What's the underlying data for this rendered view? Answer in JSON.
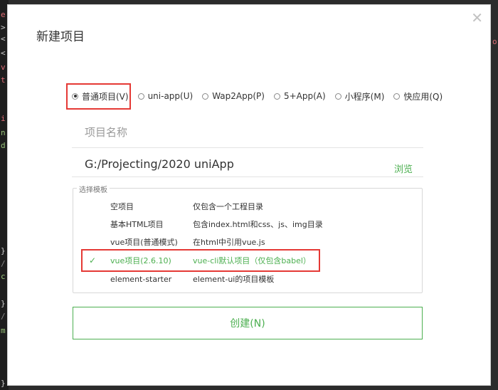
{
  "dialog": {
    "title": "新建项目",
    "close_symbol": "✕"
  },
  "project_types": [
    {
      "label": "普通项目(V)",
      "checked": true
    },
    {
      "label": "uni-app(U)",
      "checked": false
    },
    {
      "label": "Wap2App(P)",
      "checked": false
    },
    {
      "label": "5+App(A)",
      "checked": false
    },
    {
      "label": "小程序(M)",
      "checked": false
    },
    {
      "label": "快应用(Q)",
      "checked": false
    }
  ],
  "name_field": {
    "placeholder": "项目名称",
    "value": ""
  },
  "path_field": {
    "value": "G:/Projecting/2020 uniApp",
    "browse_label": "浏览"
  },
  "templates": {
    "legend": "选择模板",
    "selected_check": "✓",
    "items": [
      {
        "name": "空项目",
        "desc": "仅包含一个工程目录",
        "selected": false
      },
      {
        "name": "基本HTML项目",
        "desc": "包含index.html和css、js、img目录",
        "selected": false
      },
      {
        "name": "vue项目(普通模式)",
        "desc": "在html中引用vue.js",
        "selected": false
      },
      {
        "name": "vue项目(2.6.10)",
        "desc": "vue-cli默认项目（仅包含babel）",
        "selected": true
      },
      {
        "name": "element-starter",
        "desc": "element-ui的项目模板",
        "selected": false
      }
    ]
  },
  "create_button": {
    "label": "创建(N)"
  },
  "colors": {
    "accent": "#4caf50",
    "highlight": "#e53935",
    "background": "#2b2b2b"
  }
}
